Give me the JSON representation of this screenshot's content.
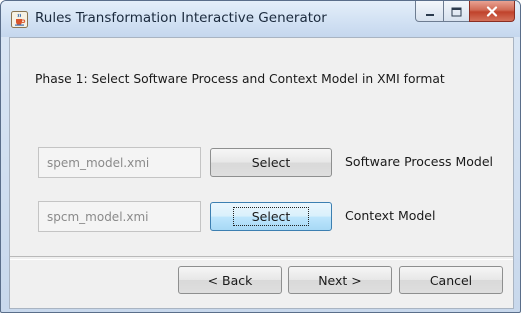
{
  "window": {
    "title": "Rules Transformation Interactive Generator",
    "icons": {
      "app": "java-cup-icon",
      "minimize": "minimize-icon",
      "maximize": "maximize-icon",
      "close": "close-icon"
    }
  },
  "phase": {
    "instruction": "Phase 1: Select Software Process and Context Model in XMI format"
  },
  "inputs": [
    {
      "value": "spem_model.xmi",
      "select_label": "Select",
      "description": "Software Process Model"
    },
    {
      "value": "spcm_model.xmi",
      "select_label": "Select",
      "description": "Context Model"
    }
  ],
  "footer": {
    "back_label": "< Back",
    "next_label": "Next >",
    "cancel_label": "Cancel"
  },
  "colors": {
    "content_bg": "#f0f0f0",
    "titlebar": "#d4e3f4",
    "focused_button": "#bee6fd",
    "close_button": "#c0422b"
  }
}
